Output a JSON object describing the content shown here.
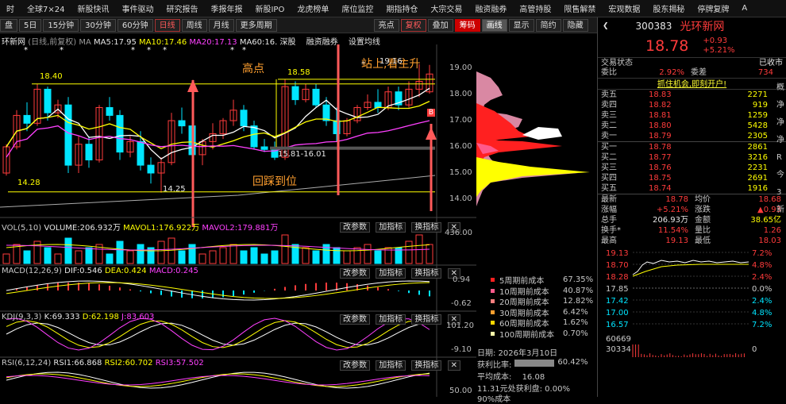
{
  "menu": [
    "时",
    "全球7×24",
    "新股快讯",
    "事件驱动",
    "研究报告",
    "季报年报",
    "新股IPO",
    "龙虎榜单",
    "席位监控",
    "期指持仓",
    "大宗交易",
    "融资融券",
    "高管持股",
    "限售解禁",
    "宏观数据",
    "股东揭秘",
    "停牌复牌",
    "A"
  ],
  "toolbar": {
    "items": [
      "盘",
      "5日",
      "15分钟",
      "30分钟",
      "60分钟",
      "日线",
      "周线",
      "月线",
      "更多周期",
      "亮点",
      "复权",
      "叠加",
      "筹码",
      "画线",
      "显示",
      "简约",
      "隐藏"
    ],
    "active": "日线"
  },
  "stock_title": "环新网",
  "title_suffix": "(日线,前复权)",
  "ma": {
    "ma_label": "MA",
    "ma5": "MA5:17.95",
    "ma10": "MA10:17.46",
    "ma20": "MA20:17.13",
    "ma60": "MA60:16.",
    "extra1": "深股",
    "extra2": "融资融券",
    "extra3": "设置均线"
  },
  "annotations": {
    "high": "高点",
    "up": "站上,看主升",
    "pullback": "回踩到位",
    "p1": "18.40",
    "p2": "18.58",
    "p3": "19.16",
    "p4": "14.28",
    "p5": "14.25",
    "p6": "15.81-16.01",
    "b": "B"
  },
  "price_axis": [
    "19.00",
    "18.00",
    "17.00",
    "16.00",
    "15.00",
    "14.00"
  ],
  "vol": {
    "label": "VOL(5,10)",
    "v": "VOLUME:206.932万",
    "m1": "MAVOL1:176.922万",
    "m2": "MAVOL2:179.881万",
    "axis": "436.00",
    "b1": "改参数",
    "b2": "加指标",
    "b3": "换指标"
  },
  "macd": {
    "label": "MACD(12,26,9)",
    "dif": "DIF:0.546",
    "dea": "DEA:0.424",
    "macd": "MACD:0.245",
    "axis1": "0.94",
    "axis2": "-0.62"
  },
  "kdj": {
    "label": "KDJ(9,3,3)",
    "k": "K:69.333",
    "d": "D:62.198",
    "j": "J:83.603",
    "axis1": "101.20",
    "axis2": "-9.10"
  },
  "rsi": {
    "label": "RSI(6,12,24)",
    "r1": "RSI1:66.868",
    "r2": "RSI2:60.702",
    "r3": "RSI3:57.502",
    "axis": "50.00"
  },
  "chips": {
    "legend": [
      {
        "label": "5周期前成本",
        "value": "67.35%",
        "color": "#ff2020"
      },
      {
        "label": "10周期前成本",
        "value": "40.87%",
        "color": "#ff5a8c"
      },
      {
        "label": "20周期前成本",
        "value": "12.82%",
        "color": "#ff7f7f"
      },
      {
        "label": "30周期前成本",
        "value": "6.42%",
        "color": "#ff9f2f"
      },
      {
        "label": "60周期前成本",
        "value": "1.62%",
        "color": "#ffd700"
      },
      {
        "label": "100周期前成本",
        "value": "0.70%",
        "color": "#ffffaa"
      }
    ],
    "date": "日期: 2026年3月10日",
    "profit_label": "获利比率:",
    "profit": "60.42%",
    "avg_label": "平均成本:",
    "avg": "16.08",
    "row1": "11.31元处获利盘: 0.00%",
    "row2": "90%成本"
  },
  "quote": {
    "code": "300383",
    "name": "光环新网",
    "price": "18.78",
    "change": "+0.93",
    "pct": "+5.21%",
    "status_label": "交易状态",
    "status": "已收市",
    "wb_label": "委比",
    "wb": "2.92%",
    "wc_label": "委差",
    "wc": "734",
    "promo": "抓住机会,即刻开户!",
    "asks": [
      {
        "n": "卖五",
        "p": "18.83",
        "v": "2271"
      },
      {
        "n": "卖四",
        "p": "18.82",
        "v": "919"
      },
      {
        "n": "卖三",
        "p": "18.81",
        "v": "1259"
      },
      {
        "n": "卖二",
        "p": "18.80",
        "v": "5428"
      },
      {
        "n": "卖一",
        "p": "18.79",
        "v": "2305"
      }
    ],
    "bids": [
      {
        "n": "买一",
        "p": "18.78",
        "v": "2861"
      },
      {
        "n": "买二",
        "p": "18.77",
        "v": "3216"
      },
      {
        "n": "买三",
        "p": "18.76",
        "v": "2231"
      },
      {
        "n": "买四",
        "p": "18.75",
        "v": "2691"
      },
      {
        "n": "买五",
        "p": "18.74",
        "v": "1916"
      }
    ],
    "stats": [
      [
        "最新",
        "18.78",
        "均价",
        "18.68"
      ],
      [
        "涨幅",
        "+5.21%",
        "涨跌",
        "▲0.93"
      ],
      [
        "总手",
        "206.93万",
        "金额",
        "38.65亿"
      ],
      [
        "换手*",
        "11.54%",
        "量比",
        "1.26"
      ],
      [
        "最高",
        "19.13",
        "最低",
        "18.03"
      ]
    ],
    "mini_left": [
      "19.13",
      "18.70",
      "18.28",
      "17.85",
      "17.42",
      "17.00",
      "16.57",
      "60669",
      "30334"
    ],
    "mini_right": [
      "7.2%",
      "4.8%",
      "2.4%",
      "0.0%",
      "2.4%",
      "4.8%",
      "7.2%",
      "",
      "0"
    ]
  },
  "side": [
    "概",
    "净",
    "净",
    "净",
    "R",
    "今",
    "3",
    "新"
  ]
}
